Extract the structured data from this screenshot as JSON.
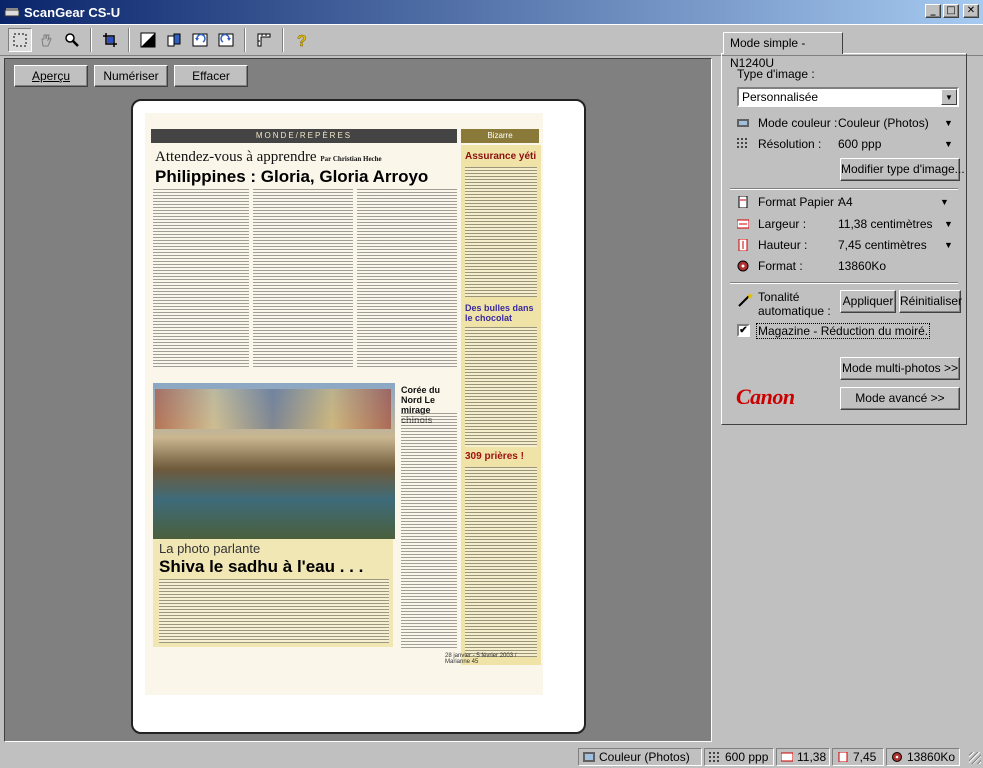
{
  "window": {
    "title": "ScanGear CS-U"
  },
  "toolbar": {
    "icons": [
      "select-marquee-icon",
      "hand-icon",
      "zoom-icon",
      "crop-icon",
      "auto-tone-icon",
      "invert-icon",
      "rotate-left-icon",
      "rotate-right-icon",
      "ruler-icon",
      "help-icon"
    ]
  },
  "preview": {
    "buttons": {
      "preview": "Aperçu",
      "scan": "Numériser",
      "clear": "Effacer"
    },
    "page": {
      "section": "MONDE/REPÈRES",
      "headline_small": "Attendez-vous à apprendre",
      "byline": "Par Christian Heche",
      "headline_big": "Philippines : Gloria, Gloria Arroyo",
      "side_label": "Bizarre",
      "side_head1": "Assurance yéti",
      "side_head2": "Des bulles dans le chocolat",
      "side_head3": "309 prières !",
      "mid_head": "Corée du Nord Le mirage chinois",
      "caption_small": "La photo parlante",
      "caption_big": "Shiva le sadhu à l'eau . . .",
      "footer": "28 janvier - 5 février 2003 / Marianne 45"
    }
  },
  "panel": {
    "tab": "Mode simple - N1240U",
    "image_type_label": "Type d'image :",
    "image_type_value": "Personnalisée",
    "color_mode_label": "Mode couleur :",
    "color_mode_value": "Couleur (Photos)",
    "resolution_label": "Résolution :",
    "resolution_value": "600 ppp",
    "modify_button": "Modifier type d'image...",
    "paper_label": "Format Papier :",
    "paper_value": "A4",
    "width_label": "Largeur :",
    "width_value": "11,38 centimètres",
    "height_label": "Hauteur :",
    "height_value": "7,45 centimètres",
    "format_label": "Format :",
    "format_value": "13860Ko",
    "auto_tone_label1": "Tonalité",
    "auto_tone_label2": "automatique :",
    "apply_button": "Appliquer",
    "reset_button": "Réinitialiser",
    "moire_label": "Magazine - Réduction du moiré.",
    "moire_checked": "✔",
    "multiphoto_button": "Mode multi-photos >>",
    "advanced_button": "Mode avancé >>",
    "brand": "Canon"
  },
  "status": {
    "color_mode": "Couleur (Photos)",
    "resolution": "600 ppp",
    "width": "11,38",
    "height": "7,45",
    "size": "13860Ko"
  },
  "colors": {
    "brand_red": "#cc0000",
    "titlebar_start": "#0a246a",
    "titlebar_end": "#a6caf0"
  }
}
